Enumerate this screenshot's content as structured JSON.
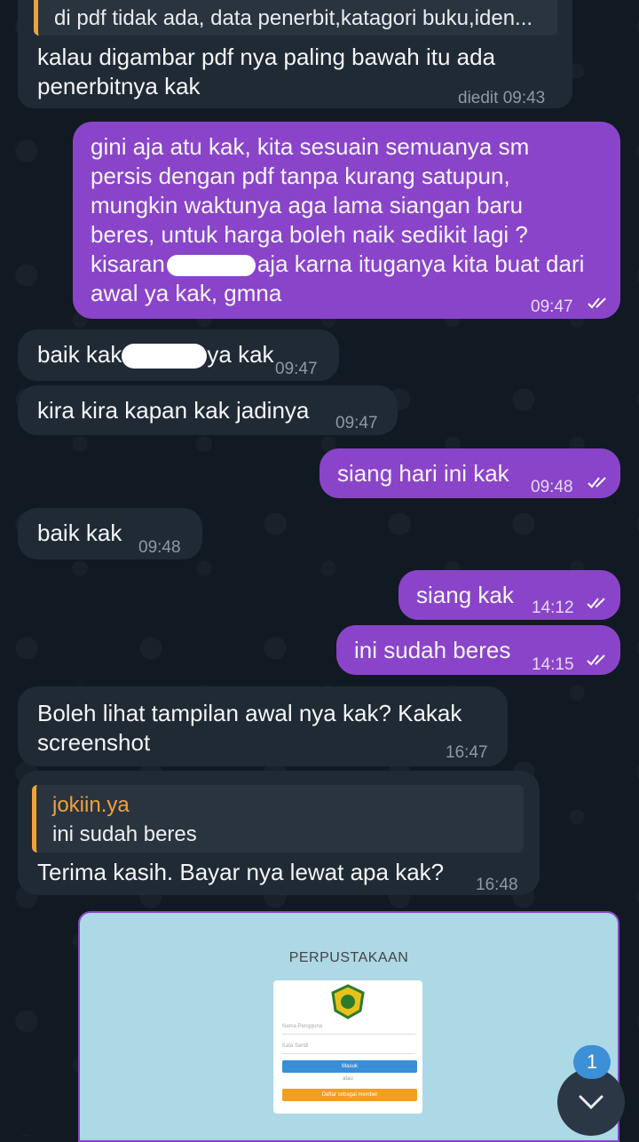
{
  "messages": [
    {
      "reply_preview": "di pdf tidak ada, data penerbit,katagori buku,iden...",
      "lines": [
        "kalau digambar pdf nya paling bawah itu ada",
        "penerbitnya kak"
      ],
      "time": "diedit 09:43"
    },
    {
      "lines": [
        "gini aja atu kak, kita sesuain semuanya sm",
        "persis dengan pdf tanpa kurang satupun,",
        "mungkin waktunya aga lama siangan baru",
        "beres, untuk harga boleh naik sedikit lagi ?",
        "kisaran",
        "aja karna ituganya kita buat dari",
        "awal ya kak, gmna"
      ],
      "time": "09:47"
    },
    {
      "text_a": "baik kak",
      "text_b": "ya kak",
      "time": "09:47"
    },
    {
      "text": "kira kira kapan kak jadinya",
      "time": "09:47"
    },
    {
      "text": "siang hari ini kak",
      "time": "09:48"
    },
    {
      "text": "baik kak",
      "time": "09:48"
    },
    {
      "text": "siang kak",
      "time": "14:12"
    },
    {
      "text": "ini sudah beres",
      "time": "14:15"
    },
    {
      "lines": [
        "Boleh lihat tampilan awal nya kak? Kakak",
        "screenshot"
      ],
      "time": "16:47"
    },
    {
      "quote_name": "jokiin.ya",
      "quote_text": "ini sudah beres",
      "text": "Terima kasih. Bayar nya lewat apa kak?",
      "time": "16:48"
    }
  ],
  "screenshot": {
    "title": "PERPUSTAKAAN",
    "username_placeholder": "Nama Pengguna",
    "password_placeholder": "Kata Sandi",
    "login_button": "Masuk",
    "or_text": "atau",
    "register_button": "Daftar sebagai member"
  },
  "unread_badge": "1",
  "colors": {
    "incoming": "#1f2a34",
    "outgoing": "#8a44c9",
    "quote_bar": "#f0a23a",
    "badge": "#3d8fd6"
  }
}
